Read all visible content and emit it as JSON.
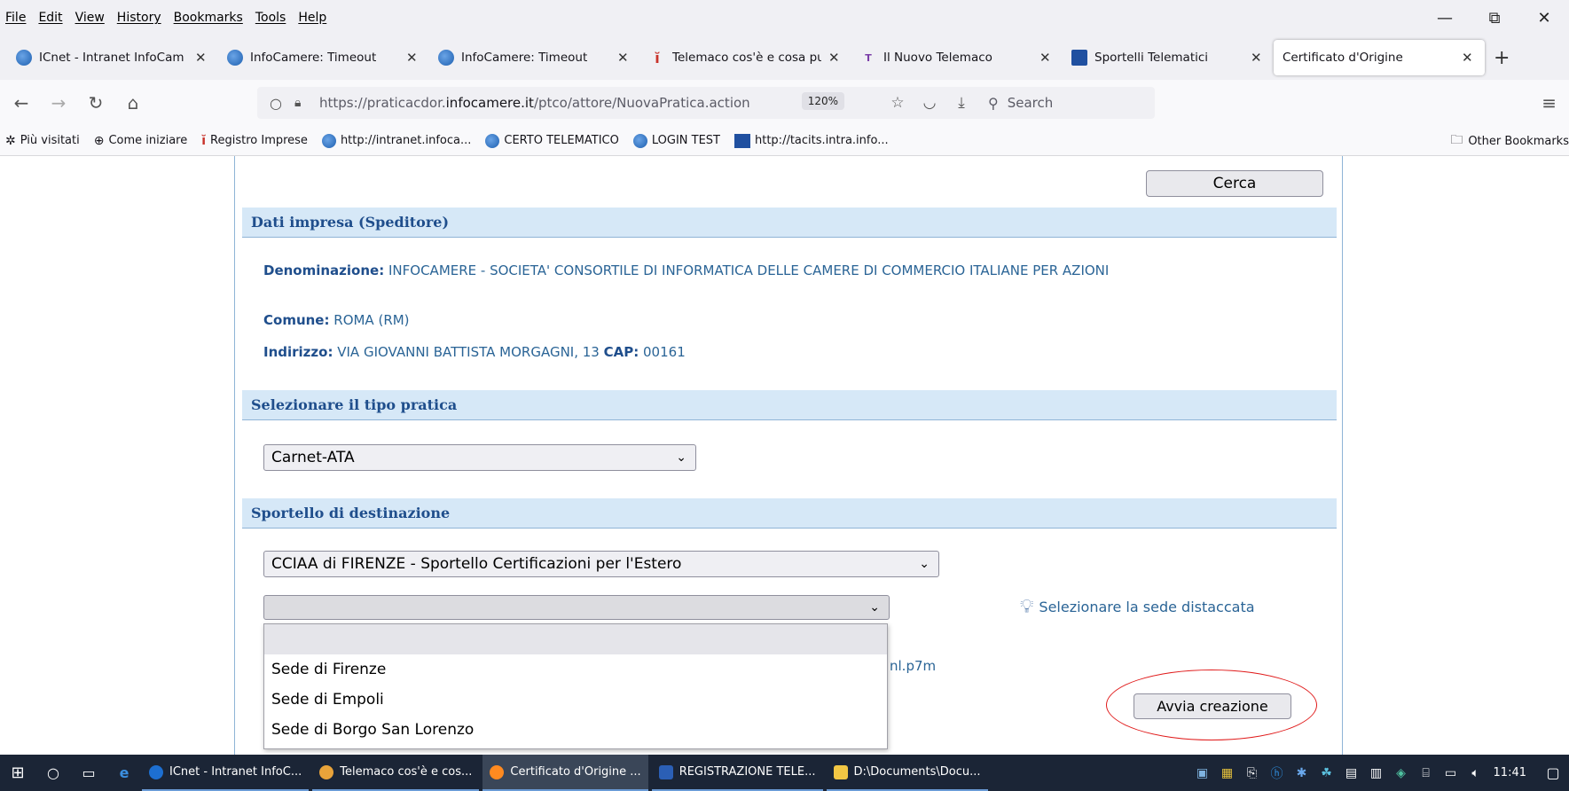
{
  "menu": [
    "File",
    "Edit",
    "View",
    "History",
    "Bookmarks",
    "Tools",
    "Help"
  ],
  "window_controls": {
    "minimize": "—",
    "restore": "⧉",
    "close": "✕"
  },
  "tabs": [
    {
      "label": "ICnet - Intranet InfoCam",
      "icon": "infocamere-icon"
    },
    {
      "label": "InfoCamere: Timeout",
      "icon": "infocamere-icon"
    },
    {
      "label": "InfoCamere: Timeout",
      "icon": "infocamere-icon"
    },
    {
      "label": "Telemaco cos'è e cosa pu",
      "icon": "telemaco-icon"
    },
    {
      "label": "Il Nuovo Telemaco",
      "icon": "nuovo-telemaco-icon"
    },
    {
      "label": "Sportelli Telematici",
      "icon": "sportelli-icon"
    },
    {
      "label": "Certificato d'Origine",
      "icon": "none",
      "active": true
    }
  ],
  "nav": {
    "url_prefix": "https://praticacdor.",
    "url_domain": "infocamere.it",
    "url_path": "/ptco/attore/NuovaPratica.action",
    "zoom": "120%",
    "search_placeholder": "Search"
  },
  "bookmarks": [
    {
      "label": "Più visitati",
      "icon": "gear-icon"
    },
    {
      "label": "Come iniziare",
      "icon": "globe-icon"
    },
    {
      "label": "Registro Imprese",
      "icon": "telemaco-icon"
    },
    {
      "label": "http://intranet.infoca...",
      "icon": "infocamere-icon"
    },
    {
      "label": "CERTO TELEMATICO",
      "icon": "infocamere-icon"
    },
    {
      "label": "LOGIN TEST",
      "icon": "infocamere-icon"
    },
    {
      "label": "http://tacits.intra.info...",
      "icon": "sportelli-icon"
    }
  ],
  "other_bookmarks": "Other Bookmarks",
  "page": {
    "cerca_label": "Cerca",
    "dati_impresa_title": "Dati impresa (Speditore)",
    "denominazione_label": "Denominazione:",
    "denominazione_value": "INFOCAMERE - SOCIETA' CONSORTILE DI INFORMATICA DELLE CAMERE DI COMMERCIO ITALIANE PER AZIONI",
    "comune_label": "Comune:",
    "comune_value": "ROMA  (RM)",
    "indirizzo_label": "Indirizzo:",
    "indirizzo_value": "VIA GIOVANNI BATTISTA MORGAGNI, 13",
    "cap_label": "CAP:",
    "cap_value": "00161",
    "tipo_pratica_title": "Selezionare il tipo pratica",
    "tipo_pratica_value": "Carnet-ATA",
    "sportello_title": "Sportello di destinazione",
    "sportello_value": "CCIAA di FIRENZE - Sportello Certificazioni per l'Estero",
    "sede_value": "",
    "sede_hint": "Selezionare la sede distaccata",
    "sede_options": [
      "",
      "Sede di Firenze",
      "Sede di Empoli",
      "Sede di Borgo San Lorenzo"
    ],
    "partial_text": "nl.p7m",
    "avvia_label": "Avvia creazione"
  },
  "taskbar": {
    "apps": [
      {
        "label": "ICnet - Intranet InfoC...",
        "color": "#1d6fd1"
      },
      {
        "label": "Telemaco cos'è e cos...",
        "color": "#e8a33a"
      },
      {
        "label": "Certificato d'Origine ...",
        "color": "#ff8a20"
      },
      {
        "label": "REGISTRAZIONE TELE...",
        "color": "#2b5fb5"
      },
      {
        "label": "D:\\Documents\\Docu...",
        "color": "#f2c744"
      }
    ],
    "clock": "11:41"
  }
}
